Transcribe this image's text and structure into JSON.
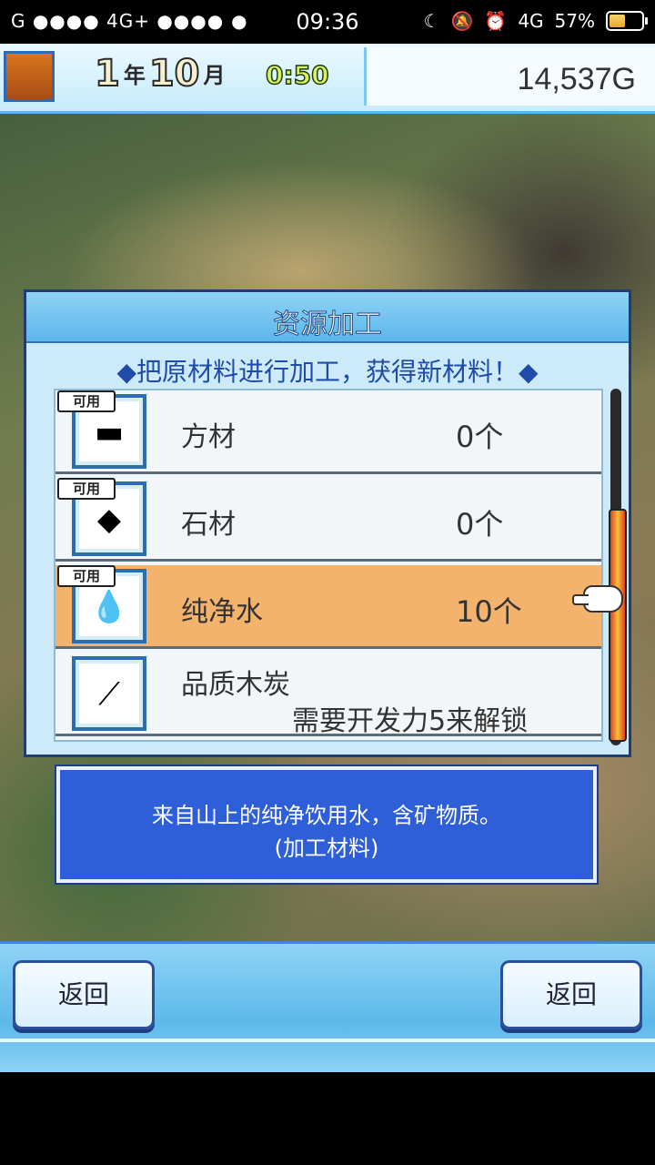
{
  "status_bar": {
    "left": "G ●●●● 4G+ ●●●●",
    "time": "09:36",
    "network": "4G",
    "battery": "57%",
    "battery_level": 0.57
  },
  "hud": {
    "year_num": "1",
    "year_unit": "年",
    "month_num": "10",
    "month_unit": "月",
    "clock": "0:50",
    "money": "14,537G"
  },
  "dialog": {
    "title": "资源加工",
    "subtitle": "◆把原材料进行加工，获得新材料！◆",
    "items": [
      {
        "tag": "可用",
        "icon": "lumber-icon",
        "glyph": "▬",
        "name": "方材",
        "count": "0个"
      },
      {
        "tag": "可用",
        "icon": "stone-icon",
        "glyph": "◆",
        "name": "石材",
        "count": "0个"
      },
      {
        "tag": "可用",
        "icon": "water-drop-icon",
        "glyph": "💧",
        "name": "纯净水",
        "count": "10个",
        "selected": true
      },
      {
        "icon": "charcoal-icon",
        "glyph": "⟋",
        "name": "品质木炭",
        "lock": "需要开发力5来解锁"
      }
    ]
  },
  "description": {
    "line1": "来自山上的纯净饮用水，含矿物质。",
    "line2": "(加工材料)"
  },
  "buttons": {
    "left": "返回",
    "right": "返回"
  }
}
